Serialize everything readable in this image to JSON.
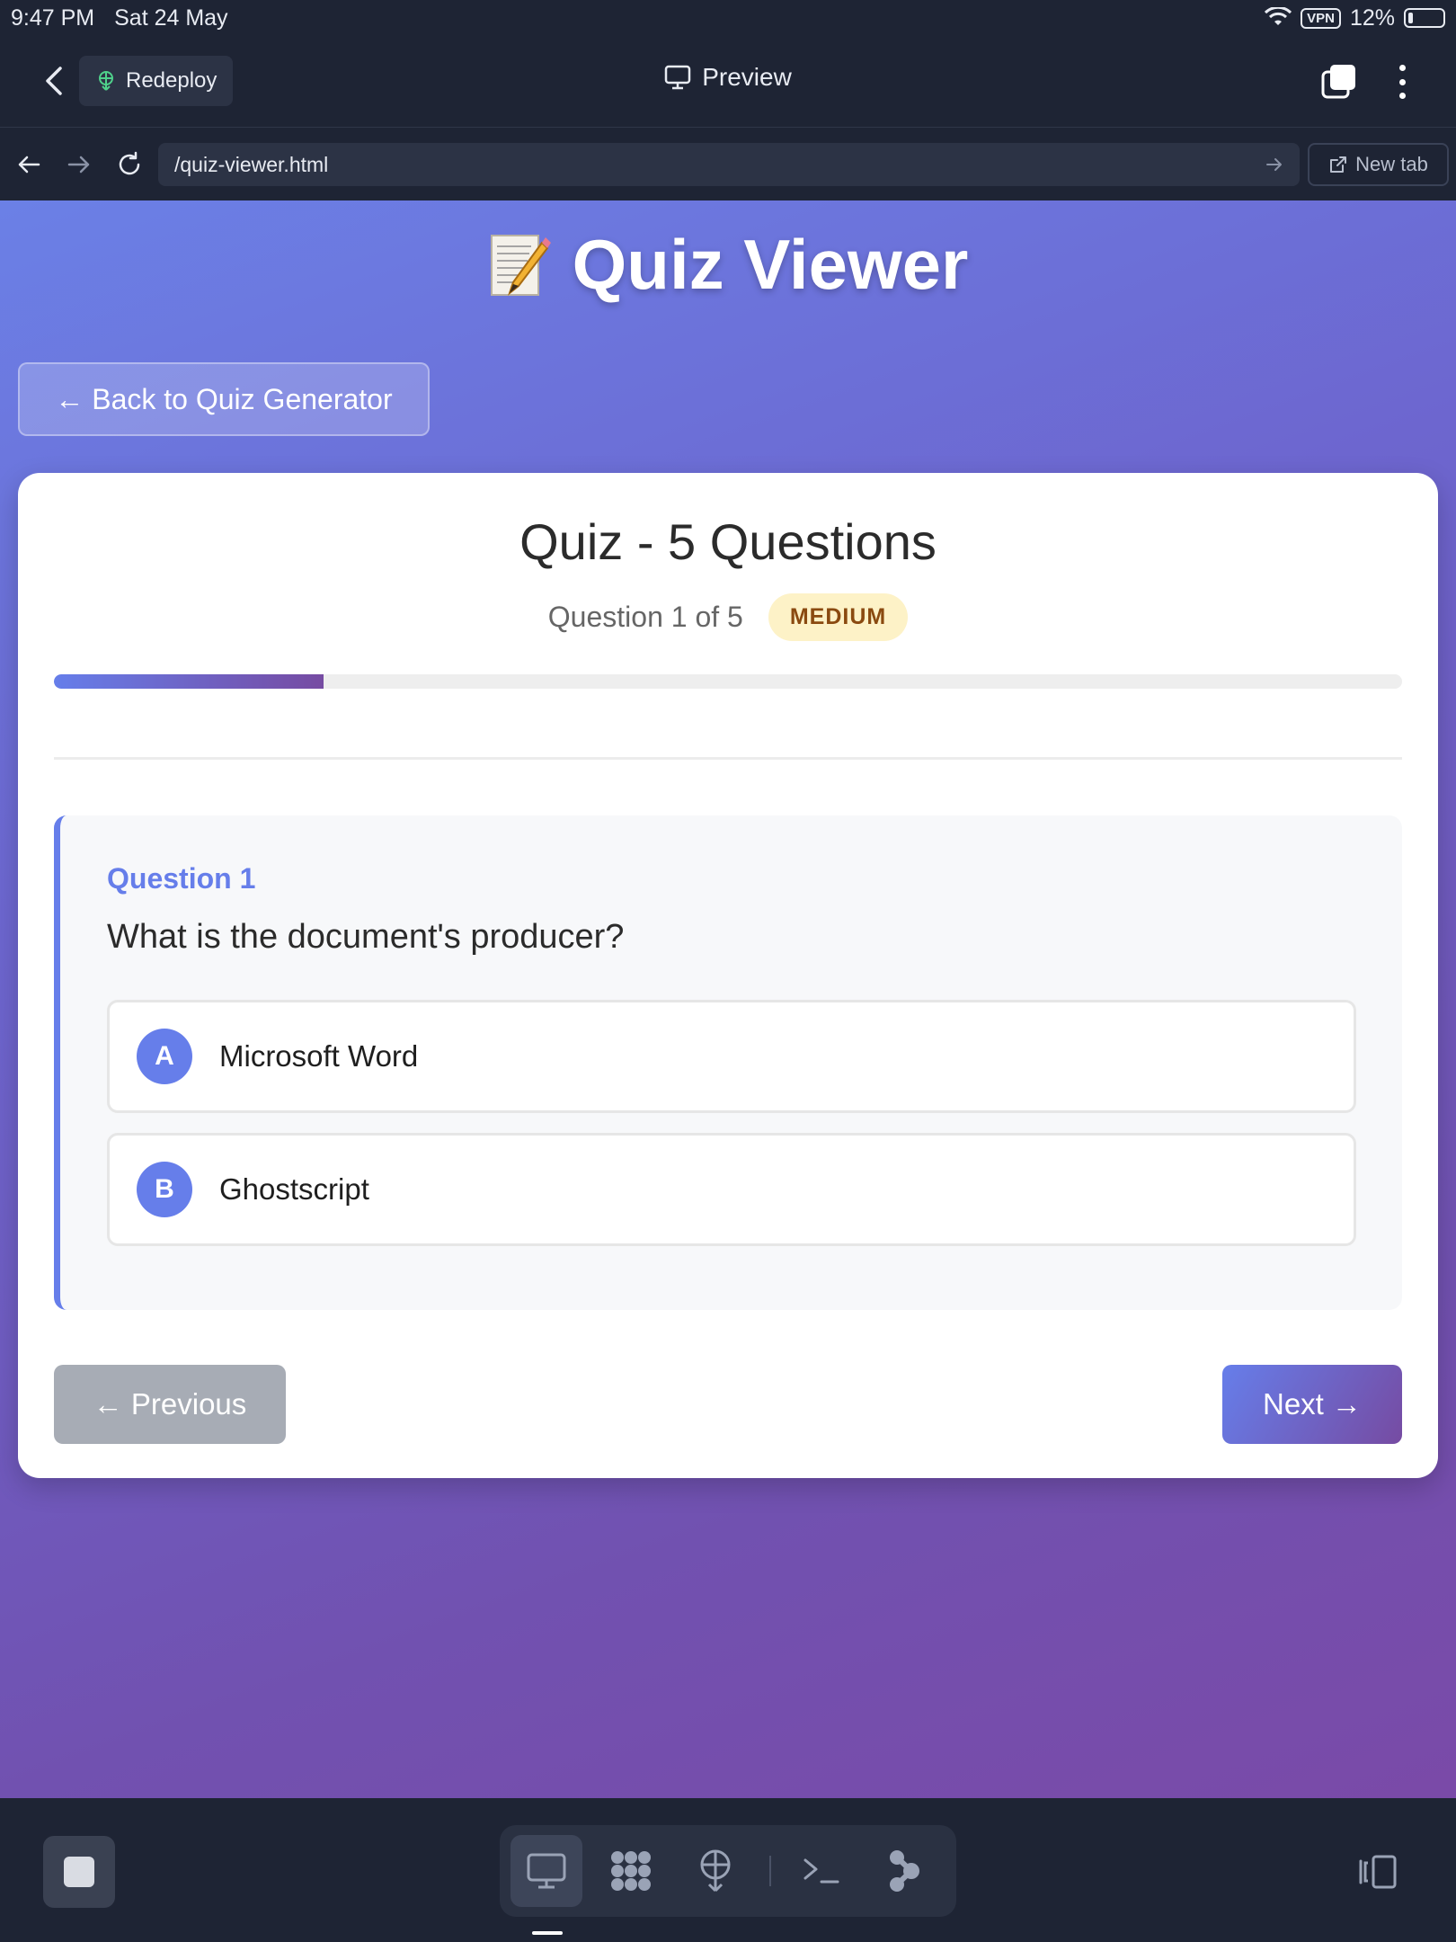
{
  "status": {
    "time": "9:47 PM",
    "date": "Sat 24 May",
    "vpn": "VPN",
    "battery": "12%"
  },
  "toolbar": {
    "redeploy_label": "Redeploy",
    "preview_label": "Preview"
  },
  "urlbar": {
    "url": "/quiz-viewer.html",
    "new_tab_label": "New tab"
  },
  "page": {
    "title": "Quiz Viewer",
    "back_button": "← Back to Quiz Generator"
  },
  "quiz": {
    "heading": "Quiz - 5 Questions",
    "counter": "Question 1 of 5",
    "difficulty": "MEDIUM",
    "progress_fraction": 0.2,
    "question_label": "Question 1",
    "question_text": "What is the document's producer?",
    "options": [
      {
        "letter": "A",
        "text": "Microsoft Word"
      },
      {
        "letter": "B",
        "text": "Ghostscript"
      }
    ],
    "prev_label": "← Previous",
    "next_label": "Next →"
  },
  "colors": {
    "accent": "#667eea",
    "accent_end": "#764ba2",
    "chrome_bg": "#1e2434"
  }
}
